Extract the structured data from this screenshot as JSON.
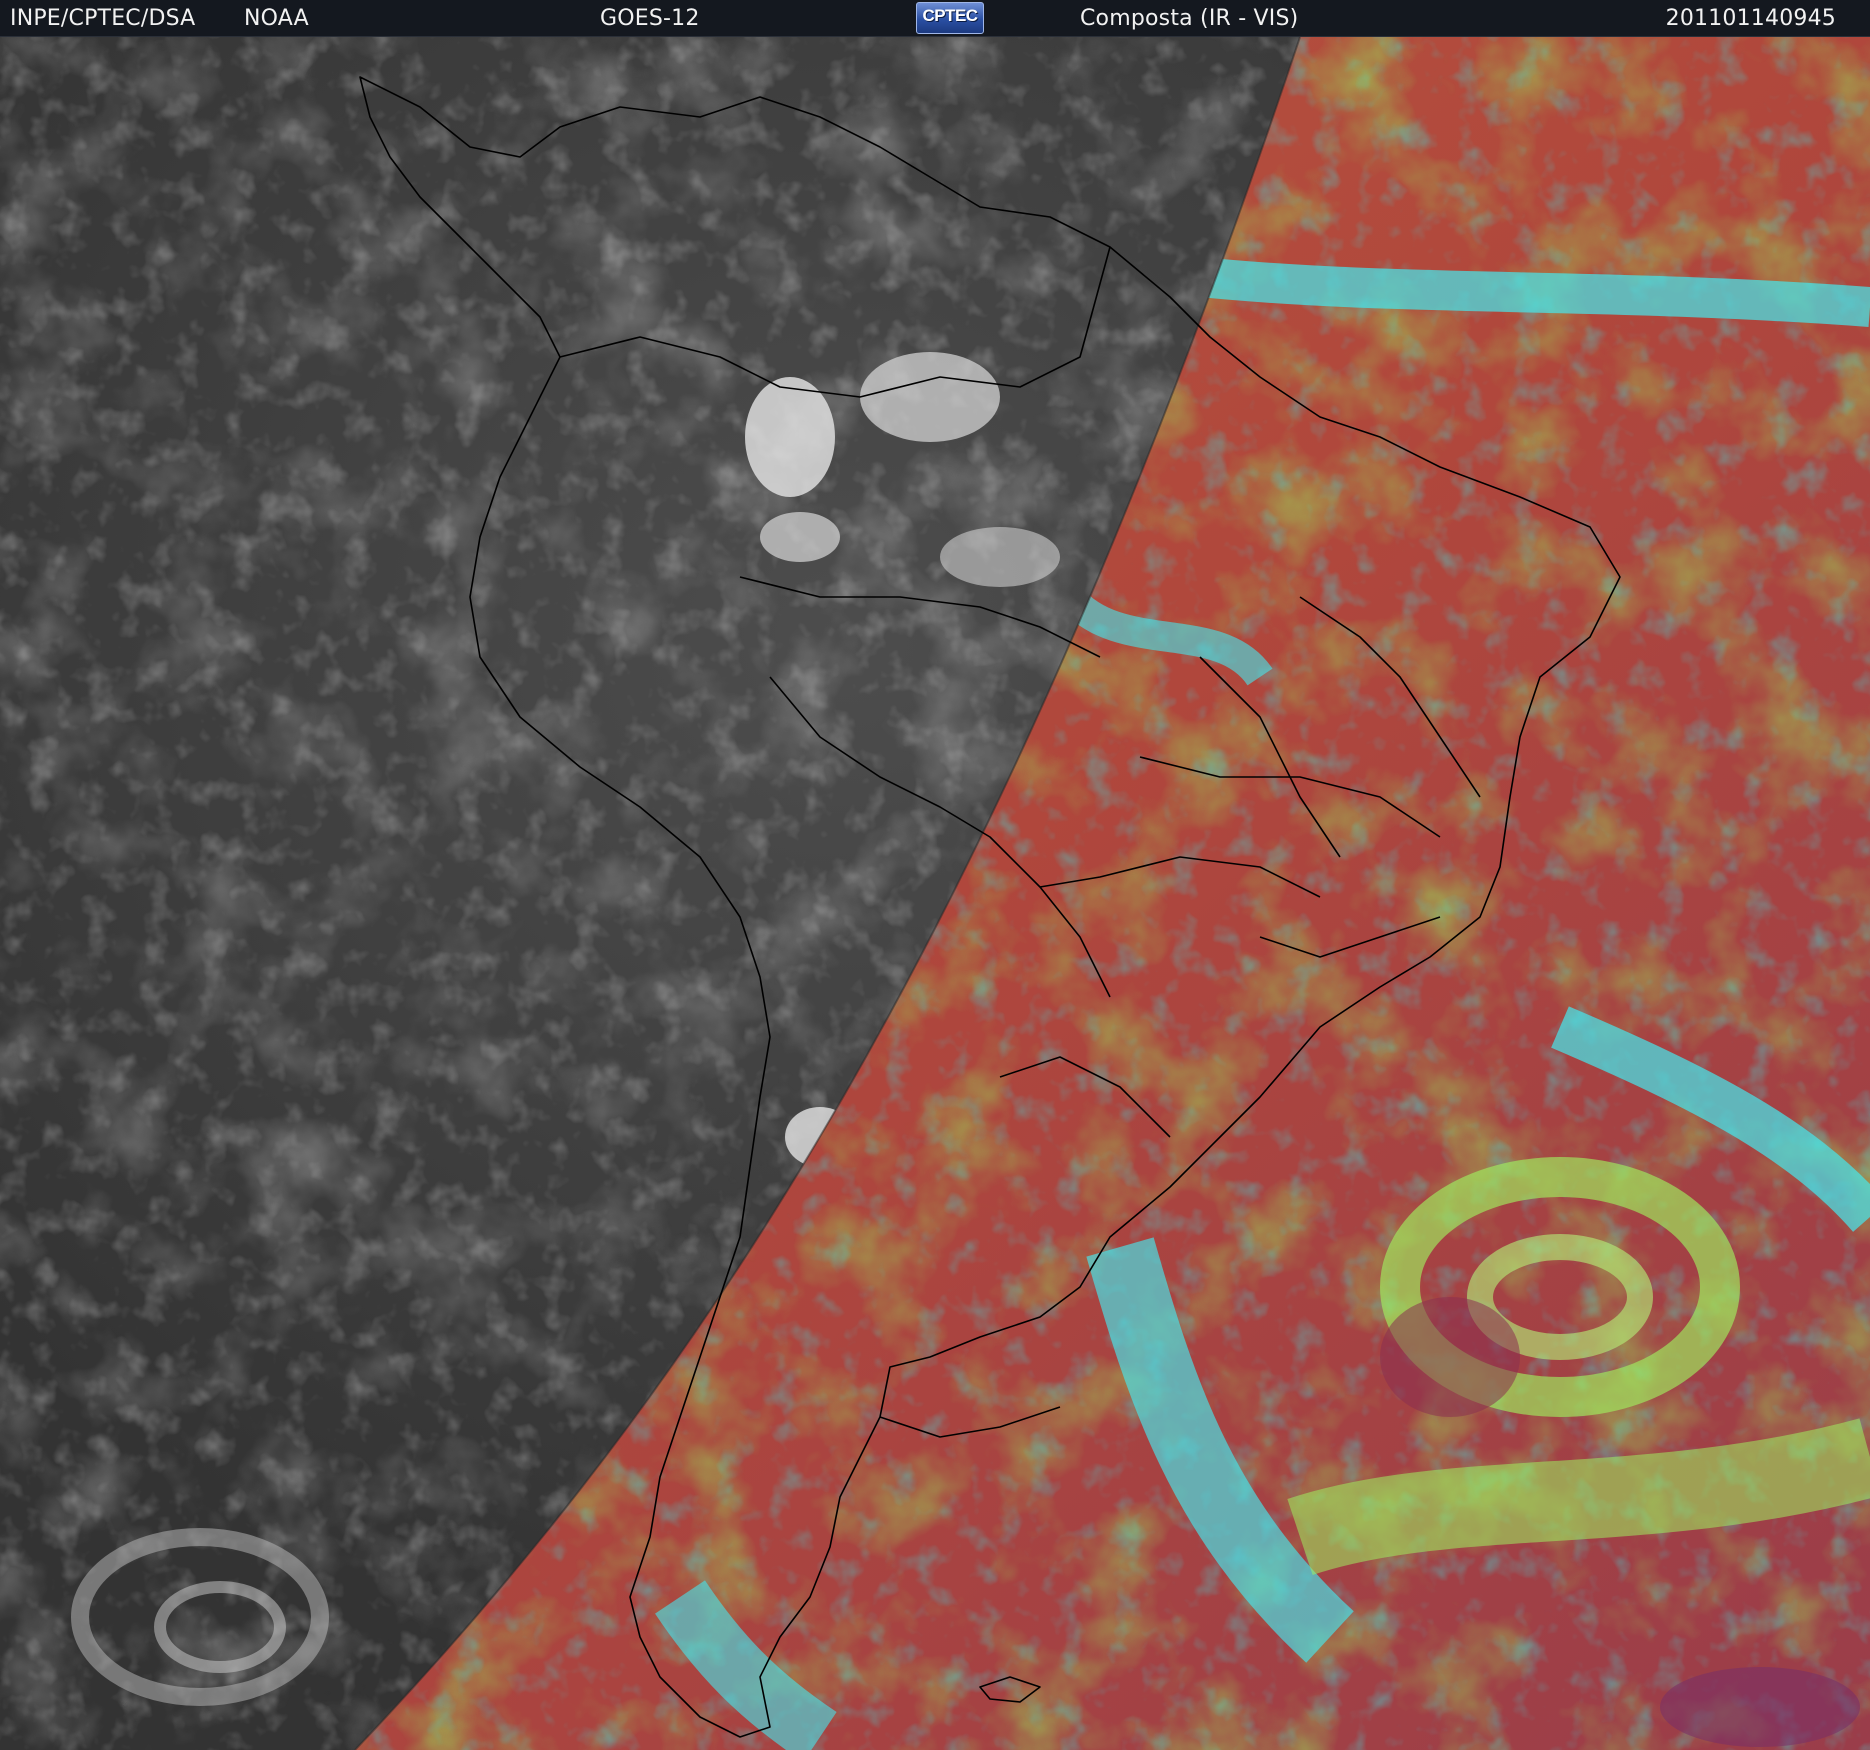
{
  "header": {
    "agency": "INPE/CPTEC/DSA",
    "source": "NOAA",
    "satellite": "GOES-12",
    "logo_text": "CPTEC",
    "product": "Composta (IR - VIS)",
    "timestamp": "201101140945"
  },
  "colors": {
    "header_bg": "#14181f",
    "ir_night": "#3a3a3a",
    "vis_day_ocean": "#b24a3a",
    "cloud_cyan": "#3fe6e6",
    "cloud_green": "#8fe85a",
    "coastline": "#000000"
  }
}
